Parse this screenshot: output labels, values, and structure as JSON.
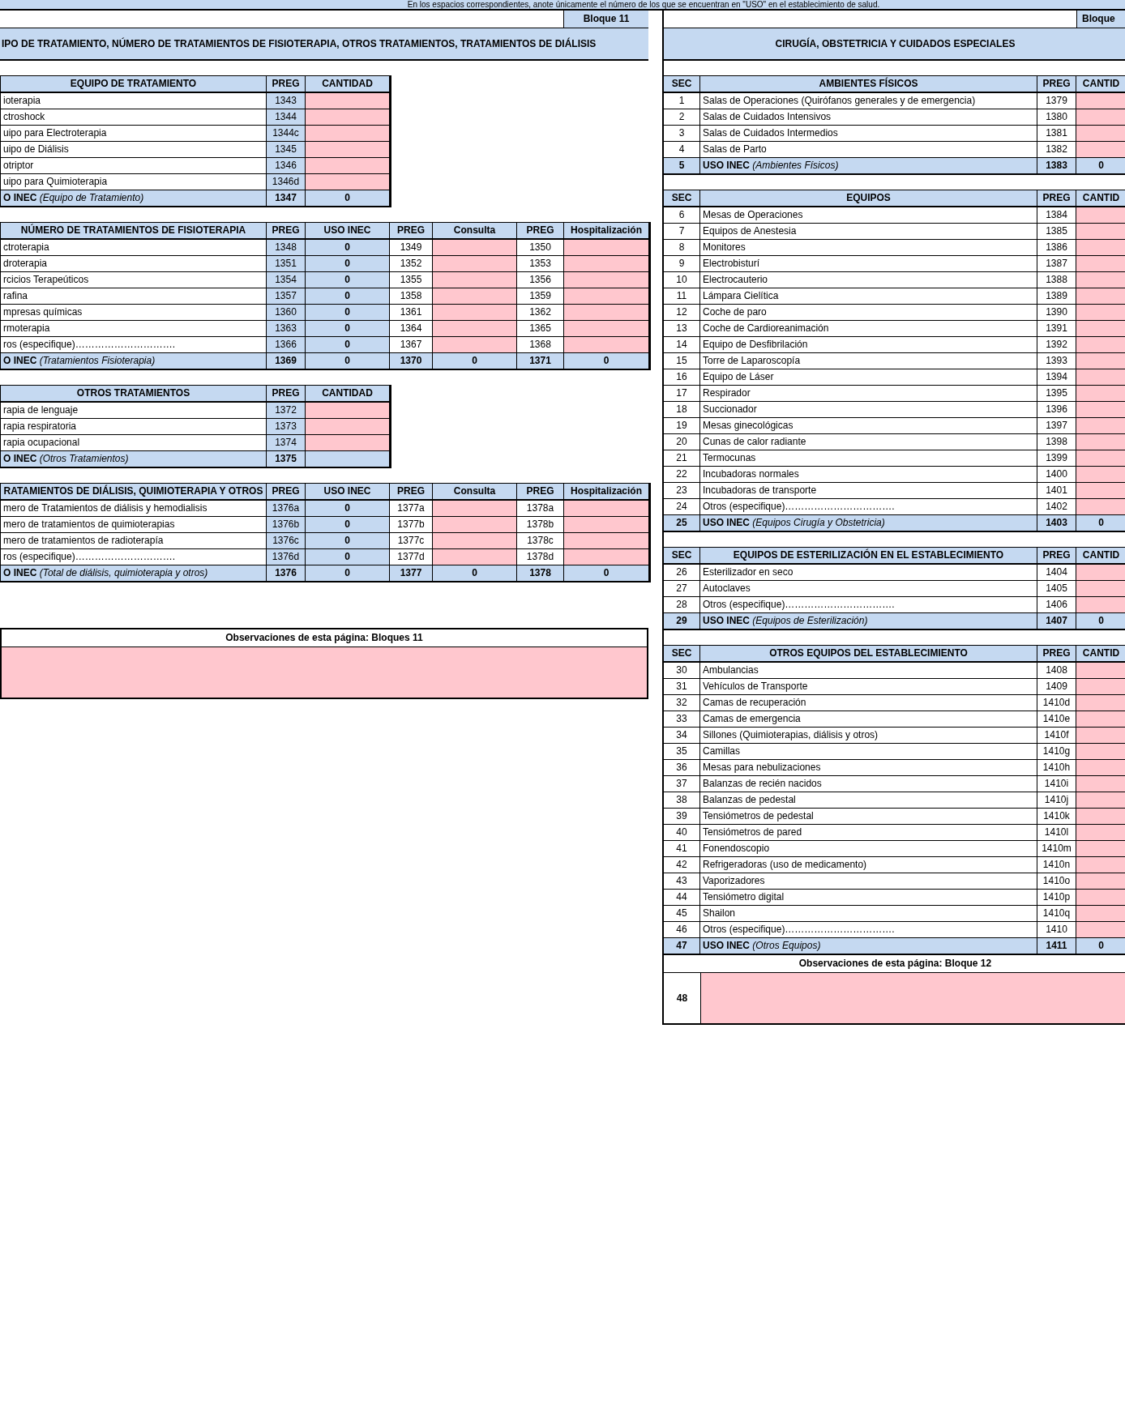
{
  "instruction": "En los espacios correspondientes, anote únicamente el número de los que se encuentran en \"USO\" en el establecimiento de salud.",
  "left": {
    "block_label": "Bloque 11",
    "title": "IPO DE TRATAMIENTO, NÚMERO DE TRATAMIENTOS DE FISIOTERAPIA, OTROS TRATAMIENTOS, TRATAMIENTOS DE DIÁLISIS",
    "tables": [
      {
        "columns": [
          {
            "label": "EQUIPO DE TRATAMIENTO",
            "kind": "label"
          },
          {
            "label": "PREG",
            "kind": "code"
          },
          {
            "label": "CANTIDAD",
            "kind": "entry"
          }
        ],
        "rows": [
          {
            "kind": "item",
            "cells": [
              "ioterapia",
              "1343",
              null
            ]
          },
          {
            "kind": "item",
            "cells": [
              "ctroshock",
              "1344",
              null
            ]
          },
          {
            "kind": "item",
            "cells": [
              "uipo para Electroterapia",
              "1344c",
              null
            ]
          },
          {
            "kind": "item",
            "cells": [
              "uipo de Diálisis",
              "1345",
              null
            ]
          },
          {
            "kind": "item",
            "cells": [
              "otriptor",
              "1346",
              null
            ]
          },
          {
            "kind": "item",
            "cells": [
              "uipo para Quimioterapia",
              "1346d",
              null
            ]
          },
          {
            "kind": "total",
            "cells": [
              "**O INEC** *(Equipo de Tratamiento)*",
              "1347",
              "0"
            ]
          }
        ]
      },
      {
        "columns": [
          {
            "label": "NÚMERO DE TRATAMIENTOS DE FISIOTERAPIA",
            "kind": "label"
          },
          {
            "label": "PREG",
            "kind": "code"
          },
          {
            "label": "USO  INEC",
            "kind": "sum"
          },
          {
            "label": "PREG",
            "kind": "ref"
          },
          {
            "label": "Consulta",
            "kind": "entry"
          },
          {
            "label": "PREG",
            "kind": "ref"
          },
          {
            "label": "Hospitalización",
            "kind": "entry"
          }
        ],
        "rows": [
          {
            "kind": "item",
            "cells": [
              "ctroterapia",
              "1348",
              "0",
              "1349",
              null,
              "1350",
              null
            ]
          },
          {
            "kind": "item",
            "cells": [
              "droterapia",
              "1351",
              "0",
              "1352",
              null,
              "1353",
              null
            ]
          },
          {
            "kind": "item",
            "cells": [
              "rcicios Terapeúticos",
              "1354",
              "0",
              "1355",
              null,
              "1356",
              null
            ]
          },
          {
            "kind": "item",
            "cells": [
              "rafina",
              "1357",
              "0",
              "1358",
              null,
              "1359",
              null
            ]
          },
          {
            "kind": "item",
            "cells": [
              "mpresas químicas",
              "1360",
              "0",
              "1361",
              null,
              "1362",
              null
            ]
          },
          {
            "kind": "item",
            "cells": [
              "rmoterapia",
              "1363",
              "0",
              "1364",
              null,
              "1365",
              null
            ]
          },
          {
            "kind": "item",
            "cells": [
              "ros (especifique)………………………….",
              "1366",
              "0",
              "1367",
              null,
              "1368",
              null
            ]
          },
          {
            "kind": "total",
            "cells": [
              "**O INEC** *(Tratamientos Fisioterapia)*",
              "1369",
              "0",
              "1370",
              "0",
              "1371",
              "0"
            ]
          }
        ]
      },
      {
        "columns": [
          {
            "label": "OTROS TRATAMIENTOS",
            "kind": "label"
          },
          {
            "label": "PREG",
            "kind": "code"
          },
          {
            "label": "CANTIDAD",
            "kind": "entry"
          }
        ],
        "rows": [
          {
            "kind": "item",
            "cells": [
              "rapia de lenguaje",
              "1372",
              null
            ]
          },
          {
            "kind": "item",
            "cells": [
              "rapia respiratoria",
              "1373",
              null
            ]
          },
          {
            "kind": "item",
            "cells": [
              "rapia ocupacional",
              "1374",
              null
            ]
          },
          {
            "kind": "total",
            "cells": [
              "**O INEC** *(Otros Tratamientos)*",
              "1375",
              null
            ]
          }
        ]
      },
      {
        "columns": [
          {
            "label": "RATAMIENTOS DE DIÁLISIS, QUIMIOTERAPIA Y OTROS",
            "kind": "label"
          },
          {
            "label": "PREG",
            "kind": "code"
          },
          {
            "label": "USO  INEC",
            "kind": "sum"
          },
          {
            "label": "PREG",
            "kind": "ref"
          },
          {
            "label": "Consulta",
            "kind": "entry"
          },
          {
            "label": "PREG",
            "kind": "ref"
          },
          {
            "label": "Hospitalización",
            "kind": "entry"
          }
        ],
        "rows": [
          {
            "kind": "item",
            "cells": [
              "mero de Tratamientos de diálisis y hemodialisis",
              "1376a",
              "0",
              "1377a",
              null,
              "1378a",
              null
            ]
          },
          {
            "kind": "item",
            "cells": [
              "mero de tratamientos de quimioterapias",
              "1376b",
              "0",
              "1377b",
              null,
              "1378b",
              null
            ]
          },
          {
            "kind": "item",
            "cells": [
              "mero de tratamientos de radioterapía",
              "1376c",
              "0",
              "1377c",
              null,
              "1378c",
              null
            ]
          },
          {
            "kind": "item",
            "cells": [
              "ros (especifique)………………………….",
              "1376d",
              "0",
              "1377d",
              null,
              "1378d",
              null
            ]
          },
          {
            "kind": "total",
            "cells": [
              "**O INEC** *(Total de diálisis, quimioterapia y otros)*",
              "1376",
              "0",
              "1377",
              "0",
              "1378",
              "0"
            ]
          }
        ]
      }
    ],
    "observations": {
      "label": "Observaciones de esta página: Bloques 11"
    }
  },
  "right": {
    "block_label": "Bloque",
    "title": "CIRUGÍA, OBSTETRICIA  Y CUIDADOS ESPECIALES",
    "tables": [
      {
        "columns": [
          {
            "label": "SEC",
            "kind": "sec"
          },
          {
            "label": "AMBIENTES FÍSICOS",
            "kind": "label"
          },
          {
            "label": "PREG",
            "kind": "ref"
          },
          {
            "label": "CANTID",
            "kind": "entry"
          }
        ],
        "rows": [
          {
            "kind": "item",
            "cells": [
              "1",
              "Salas de Operaciones (Quirófanos generales y de emergencia)",
              "1379",
              null
            ]
          },
          {
            "kind": "item",
            "cells": [
              "2",
              "Salas de Cuidados Intensivos",
              "1380",
              null
            ]
          },
          {
            "kind": "item",
            "cells": [
              "3",
              "Salas de Cuidados Intermedios",
              "1381",
              null
            ]
          },
          {
            "kind": "item",
            "cells": [
              "4",
              "Salas de Parto",
              "1382",
              null
            ]
          },
          {
            "kind": "total",
            "cells": [
              "5",
              "**USO INEC** *(Ambientes Físicos)*",
              "1383",
              "0"
            ]
          }
        ]
      },
      {
        "columns": [
          {
            "label": "SEC",
            "kind": "sec"
          },
          {
            "label": "EQUIPOS",
            "kind": "label"
          },
          {
            "label": "PREG",
            "kind": "ref"
          },
          {
            "label": "CANTID",
            "kind": "entry"
          }
        ],
        "rows": [
          {
            "kind": "item",
            "cells": [
              "6",
              "Mesas de Operaciones",
              "1384",
              null
            ]
          },
          {
            "kind": "item",
            "cells": [
              "7",
              "Equipos de Anestesia",
              "1385",
              null
            ]
          },
          {
            "kind": "item",
            "cells": [
              "8",
              "Monitores",
              "1386",
              null
            ]
          },
          {
            "kind": "item",
            "cells": [
              "9",
              "Electrobisturí",
              "1387",
              null
            ]
          },
          {
            "kind": "item",
            "cells": [
              "10",
              "Electrocauterio",
              "1388",
              null
            ]
          },
          {
            "kind": "item",
            "cells": [
              "11",
              "Lámpara Cielítica",
              "1389",
              null
            ]
          },
          {
            "kind": "item",
            "cells": [
              "12",
              "Coche de paro",
              "1390",
              null
            ]
          },
          {
            "kind": "item",
            "cells": [
              "13",
              "Coche de Cardioreanimación",
              "1391",
              null
            ]
          },
          {
            "kind": "item",
            "cells": [
              "14",
              "Equipo de Desfibrilación",
              "1392",
              null
            ]
          },
          {
            "kind": "item",
            "cells": [
              "15",
              "Torre de Laparoscopía",
              "1393",
              null
            ]
          },
          {
            "kind": "item",
            "cells": [
              "16",
              "Equipo de Láser",
              "1394",
              null
            ]
          },
          {
            "kind": "item",
            "cells": [
              "17",
              "Respirador",
              "1395",
              null
            ]
          },
          {
            "kind": "item",
            "cells": [
              "18",
              "Succionador",
              "1396",
              null
            ]
          },
          {
            "kind": "item",
            "cells": [
              "19",
              "Mesas ginecológicas",
              "1397",
              null
            ]
          },
          {
            "kind": "item",
            "cells": [
              "20",
              "Cunas de calor radiante",
              "1398",
              null
            ]
          },
          {
            "kind": "item",
            "cells": [
              "21",
              "Termocunas",
              "1399",
              null
            ]
          },
          {
            "kind": "item",
            "cells": [
              "22",
              "Incubadoras normales",
              "1400",
              null
            ]
          },
          {
            "kind": "item",
            "cells": [
              "23",
              "Incubadoras de transporte",
              "1401",
              null
            ]
          },
          {
            "kind": "item",
            "cells": [
              "24",
              "Otros (especifique)…………………………….",
              "1402",
              null
            ]
          },
          {
            "kind": "total",
            "cells": [
              "25",
              "**USO INEC** *(Equipos Cirugía y Obstetricia)*",
              "1403",
              "0"
            ]
          }
        ]
      },
      {
        "columns": [
          {
            "label": "SEC",
            "kind": "sec"
          },
          {
            "label": "EQUIPOS DE ESTERILIZACIÓN EN EL ESTABLECIMIENTO",
            "kind": "label"
          },
          {
            "label": "PREG",
            "kind": "ref"
          },
          {
            "label": "CANTID",
            "kind": "entry"
          }
        ],
        "rows": [
          {
            "kind": "item",
            "cells": [
              "26",
              "Esterilizador en seco",
              "1404",
              null
            ]
          },
          {
            "kind": "item",
            "cells": [
              "27",
              "Autoclaves",
              "1405",
              null
            ]
          },
          {
            "kind": "item",
            "cells": [
              "28",
              "Otros (especifique)…………………………….",
              "1406",
              null
            ]
          },
          {
            "kind": "total",
            "cells": [
              "29",
              "**USO INEC** *(Equipos de Esterilización)*",
              "1407",
              "0"
            ]
          }
        ]
      },
      {
        "columns": [
          {
            "label": "SEC",
            "kind": "sec"
          },
          {
            "label": "OTROS EQUIPOS DEL ESTABLECIMIENTO",
            "kind": "label"
          },
          {
            "label": "PREG",
            "kind": "ref"
          },
          {
            "label": "CANTID",
            "kind": "entry"
          }
        ],
        "rows": [
          {
            "kind": "item",
            "cells": [
              "30",
              "Ambulancias",
              "1408",
              null
            ]
          },
          {
            "kind": "item",
            "cells": [
              "31",
              "Vehículos de Transporte",
              "1409",
              null
            ]
          },
          {
            "kind": "item",
            "cells": [
              "32",
              "Camas de recuperación",
              "1410d",
              null
            ]
          },
          {
            "kind": "item",
            "cells": [
              "33",
              "Camas de emergencia",
              "1410e",
              null
            ]
          },
          {
            "kind": "item",
            "cells": [
              "34",
              "Sillones (Quimioterapias, diálisis y otros)",
              "1410f",
              null
            ]
          },
          {
            "kind": "item",
            "cells": [
              "35",
              "Camillas",
              "1410g",
              null
            ]
          },
          {
            "kind": "item",
            "cells": [
              "36",
              "Mesas para nebulizaciones",
              "1410h",
              null
            ]
          },
          {
            "kind": "item",
            "cells": [
              "37",
              "Balanzas de recién nacidos",
              "1410i",
              null
            ]
          },
          {
            "kind": "item",
            "cells": [
              "38",
              "Balanzas de pedestal",
              "1410j",
              null
            ]
          },
          {
            "kind": "item",
            "cells": [
              "39",
              "Tensiómetros de pedestal",
              "1410k",
              null
            ]
          },
          {
            "kind": "item",
            "cells": [
              "40",
              "Tensiómetros de pared",
              "1410l",
              null
            ]
          },
          {
            "kind": "item",
            "cells": [
              "41",
              "Fonendoscopio",
              "1410m",
              null
            ]
          },
          {
            "kind": "item",
            "cells": [
              "42",
              "Refrigeradoras (uso de medicamento)",
              "1410n",
              null
            ]
          },
          {
            "kind": "item",
            "cells": [
              "43",
              "Vaporizadores",
              "1410o",
              null
            ]
          },
          {
            "kind": "item",
            "cells": [
              "44",
              "Tensiómetro digital",
              "1410p",
              null
            ]
          },
          {
            "kind": "item",
            "cells": [
              "45",
              "Shailon",
              "1410q",
              null
            ]
          },
          {
            "kind": "item",
            "cells": [
              "46",
              "Otros (especifique)…………………………….",
              "1410",
              null
            ]
          },
          {
            "kind": "total",
            "cells": [
              "47",
              "**USO INEC** *(Otros Equipos)*",
              "1411",
              "0"
            ]
          }
        ]
      }
    ],
    "observations": {
      "label": "Observaciones de esta página: Bloque 12",
      "sec": "48"
    }
  }
}
